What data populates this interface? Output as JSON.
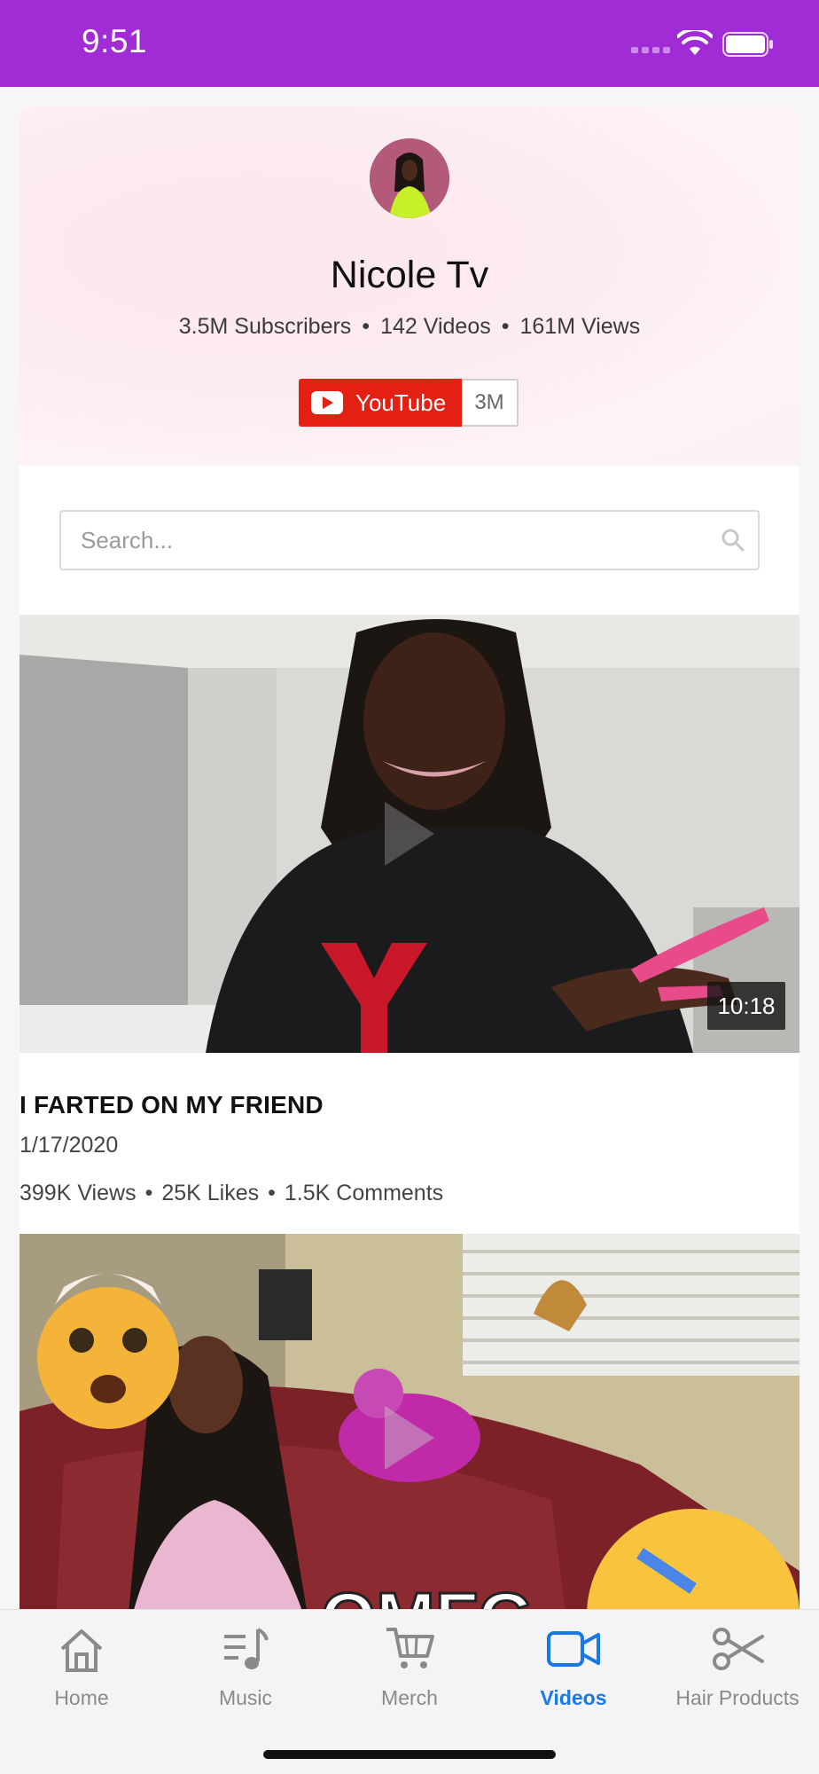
{
  "status_bar": {
    "time": "9:51"
  },
  "channel": {
    "name": "Nicole Tv",
    "subscribers": "3.5M Subscribers",
    "videos": "142 Videos",
    "views": "161M Views",
    "youtube_label": "YouTube",
    "youtube_count": "3M"
  },
  "search": {
    "placeholder": "Search..."
  },
  "videos": [
    {
      "duration": "10:18",
      "title": "I FARTED ON MY FRIEND",
      "date": "1/17/2020",
      "views": "399K Views",
      "likes": "25K Likes",
      "comments": "1.5K Comments"
    },
    {
      "overlay_text": "OMFG"
    }
  ],
  "tabs": [
    {
      "label": "Home",
      "icon": "home-icon"
    },
    {
      "label": "Music",
      "icon": "music-icon"
    },
    {
      "label": "Merch",
      "icon": "cart-icon"
    },
    {
      "label": "Videos",
      "icon": "video-camera-icon",
      "active": true
    },
    {
      "label": "Hair Products",
      "icon": "scissors-icon"
    }
  ],
  "colors": {
    "status_bar": "#a12cd6",
    "youtube": "#e42013",
    "active_tab": "#1a78e6"
  }
}
